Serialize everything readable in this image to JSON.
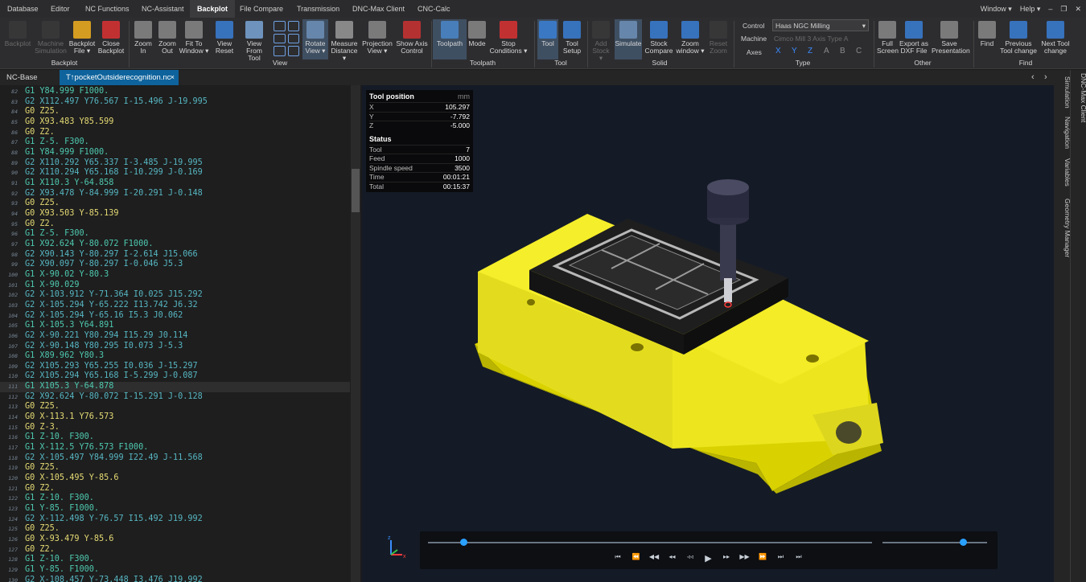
{
  "menubar": {
    "tabs": [
      "Database",
      "Editor",
      "NC Functions",
      "NC-Assistant",
      "Backplot",
      "File Compare",
      "Transmission",
      "DNC-Max Client",
      "CNC-Calc"
    ],
    "active": "Backplot",
    "right": [
      "Window ▾",
      "Help ▾"
    ]
  },
  "ribbon": {
    "buttons": [
      {
        "label": "Backplot",
        "disabled": true
      },
      {
        "label": "Machine\nSimulation",
        "disabled": true
      },
      {
        "label": "Backplot\nFile ▾",
        "disabled": false
      },
      {
        "label": "Close\nBackplot",
        "disabled": false
      },
      {
        "label": "Zoom\nIn",
        "disabled": false
      },
      {
        "label": "Zoom\nOut",
        "disabled": false
      },
      {
        "label": "Fit To\nWindow ▾",
        "disabled": false
      },
      {
        "label": "View\nReset",
        "disabled": false
      },
      {
        "label": "View From\nTool",
        "disabled": false
      },
      {
        "label": "Rotate\nView ▾",
        "disabled": false
      },
      {
        "label": "Measure\nDistance ▾",
        "disabled": false
      },
      {
        "label": "Projection\nView ▾",
        "disabled": false
      },
      {
        "label": "Show Axis\nControl",
        "disabled": false
      },
      {
        "label": "Toolpath",
        "disabled": false
      },
      {
        "label": "Mode",
        "disabled": false
      },
      {
        "label": "Stop\nConditions ▾",
        "disabled": false
      },
      {
        "label": "Tool",
        "disabled": false
      },
      {
        "label": "Tool\nSetup",
        "disabled": false
      },
      {
        "label": "Add\nStock ▾",
        "disabled": true
      },
      {
        "label": "Simulate",
        "disabled": false
      },
      {
        "label": "Stock\nCompare",
        "disabled": false
      },
      {
        "label": "Zoom\nwindow ▾",
        "disabled": false
      },
      {
        "label": "Reset\nZoom",
        "disabled": true
      },
      {
        "label": "Full\nScreen",
        "disabled": false
      },
      {
        "label": "Export as\nDXF File",
        "disabled": false
      },
      {
        "label": "Save\nPresentation",
        "disabled": false
      },
      {
        "label": "Find",
        "disabled": false
      },
      {
        "label": "Previous\nTool change",
        "disabled": false
      },
      {
        "label": "Next Tool\nchange",
        "disabled": false
      }
    ],
    "groups": [
      "Backplot",
      "View",
      "Toolpath",
      "Tool",
      "Solid",
      "Type",
      "Other",
      "Find"
    ],
    "control": {
      "label": "Control",
      "value": "Haas NGC Milling",
      "machine_label": "Machine",
      "machine_value": "Cimco Mill 3 Axis Type A",
      "axes_label": "Axes",
      "axes": [
        "X",
        "Y",
        "Z",
        "A",
        "B",
        "C"
      ]
    }
  },
  "doc_tabs": [
    "NC-Base",
    "T↑pocketOutsiderecognition.nc"
  ],
  "doc_tab_close": "×",
  "nc_lines": [
    {
      "n": "82",
      "t": "G1 Y84.999 F1000."
    },
    {
      "n": "83",
      "t": "G2 X112.497 Y76.567 I-15.496 J-19.995"
    },
    {
      "n": "84",
      "t": "G0 Z25."
    },
    {
      "n": "85",
      "t": "G0 X93.483 Y85.599"
    },
    {
      "n": "86",
      "t": "G0 Z2."
    },
    {
      "n": "87",
      "t": "G1 Z-5. F300."
    },
    {
      "n": "88",
      "t": "G1 Y84.999 F1000."
    },
    {
      "n": "89",
      "t": "G2 X110.292 Y65.337 I-3.485 J-19.995"
    },
    {
      "n": "90",
      "t": "G2 X110.294 Y65.168 I-10.299 J-0.169"
    },
    {
      "n": "91",
      "t": "G1 X110.3 Y-64.858"
    },
    {
      "n": "92",
      "t": "G2 X93.478 Y-84.999 I-20.291 J-0.148"
    },
    {
      "n": "93",
      "t": "G0 Z25."
    },
    {
      "n": "94",
      "t": "G0 X93.503 Y-85.139"
    },
    {
      "n": "95",
      "t": "G0 Z2."
    },
    {
      "n": "96",
      "t": "G1 Z-5. F300."
    },
    {
      "n": "97",
      "t": "G1 X92.624 Y-80.072 F1000."
    },
    {
      "n": "98",
      "t": "G2 X90.143 Y-80.297 I-2.614 J15.066"
    },
    {
      "n": "99",
      "t": "G2 X90.097 Y-80.297 I-0.046 J5.3"
    },
    {
      "n": "100",
      "t": "G1 X-90.02 Y-80.3"
    },
    {
      "n": "101",
      "t": "G1 X-90.029"
    },
    {
      "n": "102",
      "t": "G2 X-103.912 Y-71.364 I0.025 J15.292"
    },
    {
      "n": "103",
      "t": "G2 X-105.294 Y-65.222 I13.742 J6.32"
    },
    {
      "n": "104",
      "t": "G2 X-105.294 Y-65.16 I5.3 J0.062"
    },
    {
      "n": "105",
      "t": "G1 X-105.3 Y64.891"
    },
    {
      "n": "106",
      "t": "G2 X-90.221 Y80.294 I15.29 J0.114"
    },
    {
      "n": "107",
      "t": "G2 X-90.148 Y80.295 I0.073 J-5.3"
    },
    {
      "n": "108",
      "t": "G1 X89.962 Y80.3"
    },
    {
      "n": "109",
      "t": "G2 X105.293 Y65.255 I0.036 J-15.297"
    },
    {
      "n": "110",
      "t": "G2 X105.294 Y65.168 I-5.299 J-0.087"
    },
    {
      "n": "111",
      "t": "G1 X105.3 Y-64.878"
    },
    {
      "n": "112",
      "t": "G2 X92.624 Y-80.072 I-15.291 J-0.128"
    },
    {
      "n": "113",
      "t": "G0 Z25."
    },
    {
      "n": "114",
      "t": "G0 X-113.1 Y76.573"
    },
    {
      "n": "115",
      "t": "G0 Z-3."
    },
    {
      "n": "116",
      "t": "G1 Z-10. F300."
    },
    {
      "n": "117",
      "t": "G1 X-112.5 Y76.573 F1000."
    },
    {
      "n": "118",
      "t": "G2 X-105.497 Y84.999 I22.49 J-11.568"
    },
    {
      "n": "119",
      "t": "G0 Z25."
    },
    {
      "n": "120",
      "t": "G0 X-105.495 Y-85.6"
    },
    {
      "n": "121",
      "t": "G0 Z2."
    },
    {
      "n": "122",
      "t": "G1 Z-10. F300."
    },
    {
      "n": "123",
      "t": "G1 Y-85. F1000."
    },
    {
      "n": "124",
      "t": "G2 X-112.498 Y-76.57 I15.492 J19.992"
    },
    {
      "n": "125",
      "t": "G0 Z25."
    },
    {
      "n": "126",
      "t": "G0 X-93.479 Y-85.6"
    },
    {
      "n": "127",
      "t": "G0 Z2."
    },
    {
      "n": "128",
      "t": "G1 Z-10. F300."
    },
    {
      "n": "129",
      "t": "G1 Y-85. F1000."
    },
    {
      "n": "130",
      "t": "G2 X-108.457 Y-73.448 I3.476 J19.992"
    }
  ],
  "current_line": "111",
  "tool_position": {
    "title": "Tool position",
    "unit": "mm",
    "rows": [
      {
        "k": "X",
        "v": "105.297"
      },
      {
        "k": "Y",
        "v": "-7.792"
      },
      {
        "k": "Z",
        "v": "-5.000"
      }
    ]
  },
  "status": {
    "title": "Status",
    "rows": [
      {
        "k": "Tool",
        "v": "7"
      },
      {
        "k": "Feed",
        "v": "1000"
      },
      {
        "k": "Spindle speed",
        "v": "3500"
      },
      {
        "k": "Time",
        "v": "00:01:21"
      },
      {
        "k": "Total",
        "v": "00:15:37"
      }
    ]
  },
  "side_tabs": [
    "Simulation",
    "Navigation",
    "Variables",
    "Geometry Manager",
    "DNC-Max Client"
  ],
  "player": {
    "progress": 0.08,
    "speed": 0.77
  },
  "colors": {
    "accent": "#0e639c",
    "vise": "#f5ee2a",
    "knob": "#2aa0ff"
  }
}
